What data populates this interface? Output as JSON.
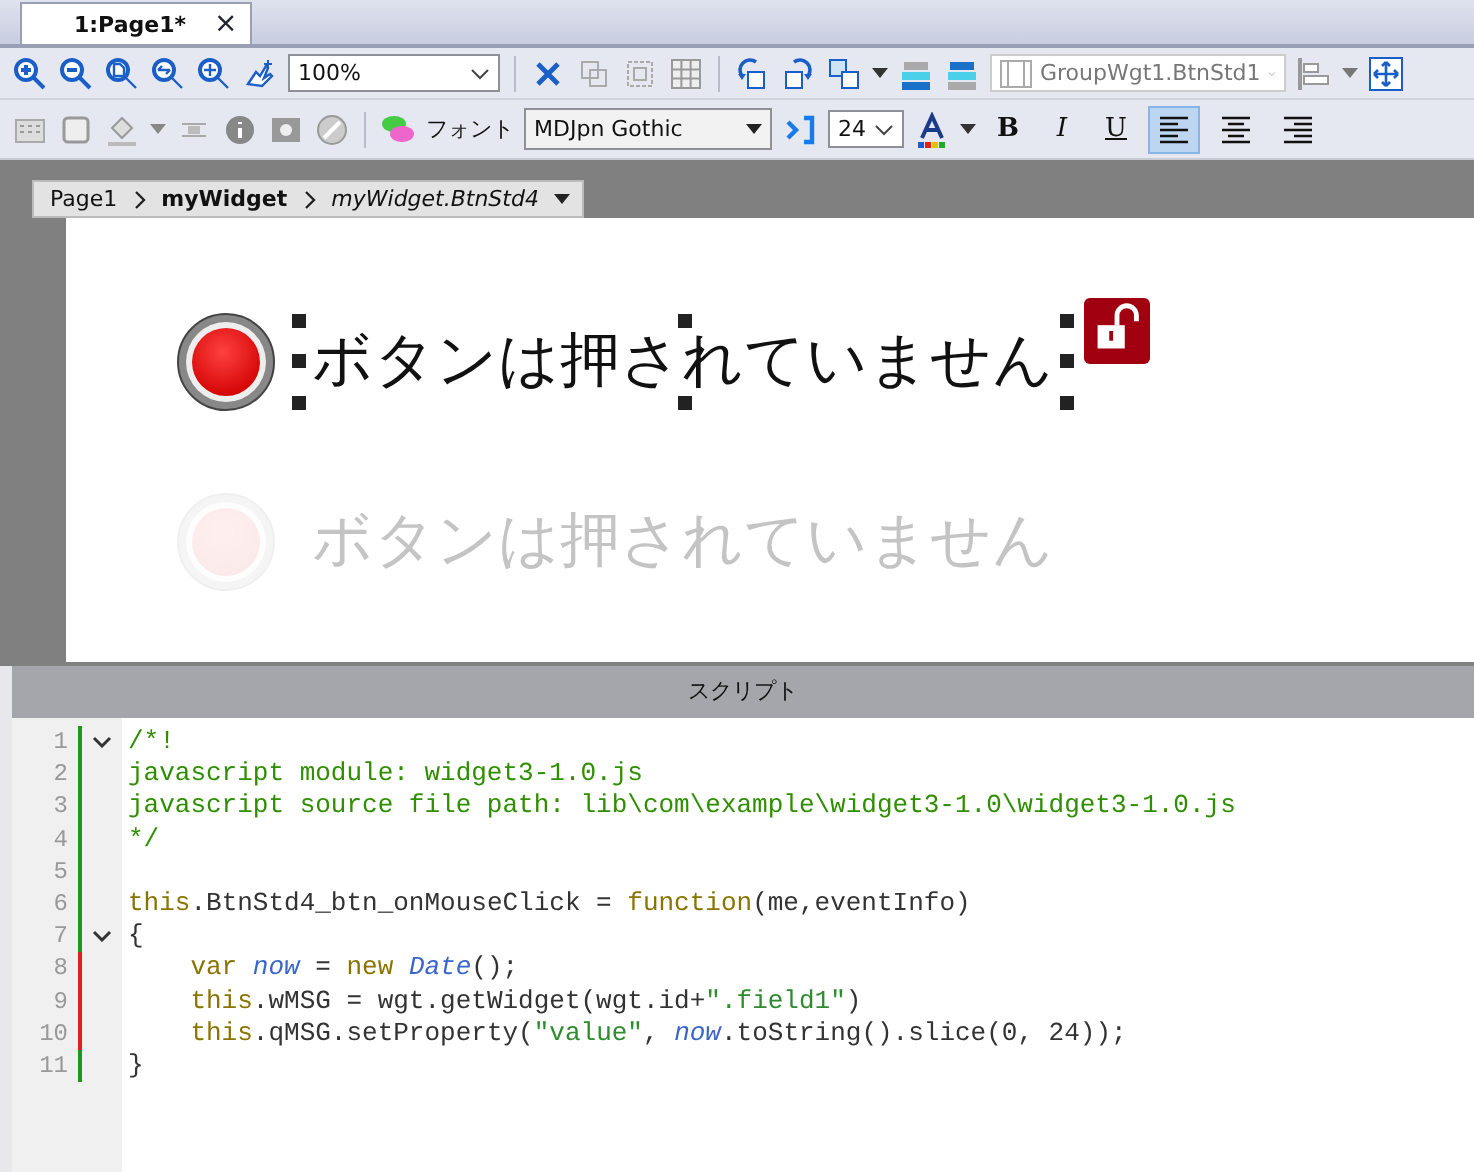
{
  "tabs": [
    {
      "label": "1:Page1*",
      "close": "×",
      "selected": true
    }
  ],
  "toolbar": {
    "zoom": "100%",
    "widget_select": {
      "value": "GroupWgt1.BtnStd1",
      "disabled": true
    }
  },
  "format_bar": {
    "font_label": "フォント",
    "font": "MDJpn Gothic",
    "size": "24",
    "bold": "B",
    "italic": "I",
    "underline": "U",
    "alignment": [
      {
        "selected": true
      },
      {
        "selected": false
      },
      {
        "selected": false
      }
    ]
  },
  "breadcrumb": [
    {
      "label": "Page1",
      "kind": "plain"
    },
    {
      "label": "myWidget",
      "kind": "bold"
    },
    {
      "label": "myWidget.BtnStd4",
      "kind": "italic"
    }
  ],
  "canvas": {
    "widgets": [
      {
        "label": "ボタンは押されていません",
        "selected": true,
        "ghost": false
      },
      {
        "label": "ボタンは押されていません",
        "selected": false,
        "ghost": true
      }
    ]
  },
  "script_panel": {
    "title": "スクリプト",
    "lines": [
      {
        "number": "1",
        "foldable": true,
        "color": "#1a9a1a",
        "tokens": [
          {
            "kind": "comment",
            "text": "/*!"
          }
        ]
      },
      {
        "number": "2",
        "foldable": false,
        "color": "#1a9a1a",
        "tokens": [
          {
            "kind": "comment",
            "text": "javascript module: widget3-1.0.js"
          }
        ]
      },
      {
        "number": "3",
        "foldable": false,
        "color": "#1a9a1a",
        "tokens": [
          {
            "kind": "comment",
            "text": "javascript source file path: lib\\com\\example\\widget3-1.0\\widget3-1.0.js"
          }
        ]
      },
      {
        "number": "4",
        "foldable": false,
        "color": "#1a9a1a",
        "tokens": [
          {
            "kind": "comment",
            "text": "*/"
          }
        ]
      },
      {
        "number": "5",
        "foldable": false,
        "color": "#1a9a1a"
      },
      {
        "number": "6",
        "foldable": false,
        "color": "#1a9a1a",
        "tokens": [
          {
            "kind": "keyword",
            "text": "this"
          },
          {
            "kind": "plain",
            "text": ".BtnStd4_btn_onMouseClick = "
          },
          {
            "kind": "keyword",
            "text": "function"
          },
          {
            "kind": "plain",
            "text": "(me,eventInfo)"
          }
        ]
      },
      {
        "number": "7",
        "foldable": true,
        "color": "#1a9a1a",
        "tokens": [
          {
            "kind": "plain",
            "text": "{"
          }
        ]
      },
      {
        "number": "8",
        "foldable": false,
        "color": "#e02020",
        "tokens": [
          {
            "kind": "keyword",
            "text": "    var "
          },
          {
            "kind": "name",
            "text": "now"
          },
          {
            "kind": "plain",
            "text": " = "
          },
          {
            "kind": "keyword",
            "text": "new "
          },
          {
            "kind": "name",
            "text": "Date"
          },
          {
            "kind": "plain",
            "text": "();"
          }
        ]
      },
      {
        "number": "9",
        "foldable": false,
        "color": "#e02020",
        "tokens": [
          {
            "kind": "keyword",
            "text": "    this"
          },
          {
            "kind": "plain",
            "text": ".wMSG = wgt.getWidget(wgt.id+"
          },
          {
            "kind": "string",
            "text": "\".field1\""
          },
          {
            "kind": "plain",
            "text": ")"
          }
        ]
      },
      {
        "number": "10",
        "foldable": false,
        "color": "#e02020",
        "tokens": [
          {
            "kind": "keyword",
            "text": "    this"
          },
          {
            "kind": "plain",
            "text": ".qMSG.setProperty("
          },
          {
            "kind": "string",
            "text": "\"value\""
          },
          {
            "kind": "plain",
            "text": ", "
          },
          {
            "kind": "name",
            "text": "now"
          },
          {
            "kind": "plain",
            "text": ".toString().slice(0, 24));"
          }
        ]
      },
      {
        "number": "11",
        "foldable": false,
        "color": "#1a9a1a",
        "tokens": [
          {
            "kind": "plain",
            "text": "}"
          }
        ]
      }
    ]
  }
}
